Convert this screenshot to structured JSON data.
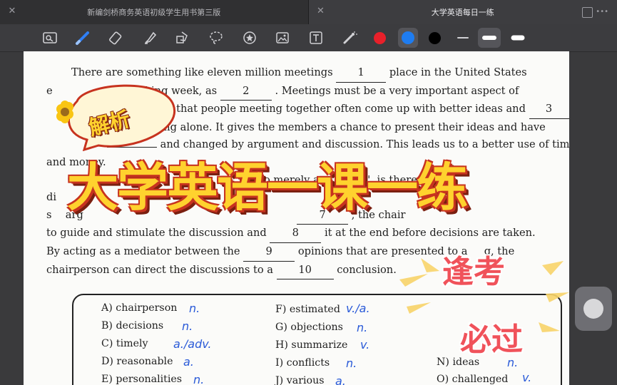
{
  "tabs": [
    {
      "title": "新编剑桥商务英语初级学生用书第三版",
      "active": false
    },
    {
      "title": "大学英语每日一练",
      "active": true
    }
  ],
  "toolbar": {
    "tools": [
      "scan-icon",
      "pen-icon",
      "eraser-icon",
      "highlighter-icon",
      "shapes-icon",
      "lasso-icon",
      "sticker-icon",
      "image-icon",
      "textbox-icon",
      "laser-icon"
    ],
    "colors": [
      "#e8202a",
      "#1e7cf0",
      "#000000"
    ],
    "selected_color": "#1e7cf0"
  },
  "passage": {
    "l1a": "There are something like eleven million meetings",
    "b1": "1",
    "l1b": "place in the United States",
    "l2a": "e",
    "l2b": "working week, as",
    "b2": "2",
    "l2c": ". Meetings must be a very important aspect of",
    "l3a": "son is that people meeting together often come up with better ideas and",
    "b3": "3",
    "l4a": "orking alone. It gives the members a chance to present their ideas and have",
    "l5a": "and changed by argument and discussion. This leads us to a better use of time",
    "l6a": "and money.",
    "l7a": "o merely as",
    "l7b": "\", is there t",
    "l8a": "di",
    "l9a": "s",
    "l9b": "arg",
    "b7": "7",
    "l9c": ", the chair",
    "l10a": "to guide and stimulate the discussion and",
    "b8": "8",
    "l10b": "it at the end before decisions are taken.",
    "l11a": "By acting as a mediator between the",
    "b9": "9",
    "l11b": "opinions that are presented to a",
    "l11c": "g, the",
    "l12a": "chairperson can direct the discussions to a",
    "b10": "10",
    "l12b": "conclusion."
  },
  "words": {
    "a": "A) chairperson",
    "b": "B) decisions",
    "c": "C) timely",
    "d": "D) reasonable",
    "e": "E) personalities",
    "f": "F) estimated",
    "g": "G) objections",
    "h": "H) summarize",
    "i": "I) conflicts",
    "j": "J) various",
    "n": "N) ideas",
    "o": "O) challenged"
  },
  "notes": {
    "a": "n.",
    "b": "n.",
    "c": "a./adv.",
    "d": "a.",
    "e": "n.",
    "f": "v./a.",
    "g": "n.",
    "h": "v.",
    "i": "n.",
    "j": "a.",
    "n": "n.",
    "o": "v."
  },
  "overlay": {
    "tag": "解析",
    "title": "大学英语一课一练",
    "stamp1": "逢考",
    "stamp2": "必过"
  }
}
